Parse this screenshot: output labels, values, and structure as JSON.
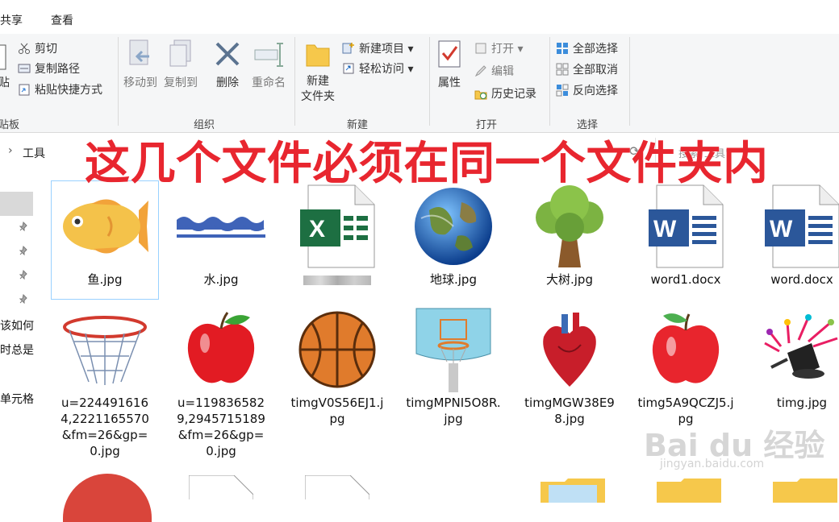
{
  "tabs": [
    "共享",
    "查看"
  ],
  "ribbon": {
    "clipboard": {
      "paste_partial": "贴",
      "group_partial": "贴板",
      "cut": "剪切",
      "copy_path": "复制路径",
      "paste_shortcut": "粘贴快捷方式"
    },
    "organize": {
      "label": "组织",
      "move_to": "移动到",
      "copy_to": "复制到",
      "delete": "删除",
      "rename": "重命名"
    },
    "new": {
      "label": "新建",
      "new_folder": "新建\n文件夹",
      "new_item": "新建项目 ▾",
      "easy_access": "轻松访问 ▾"
    },
    "open": {
      "label": "打开",
      "properties": "属性",
      "open": "打开 ▾",
      "edit": "编辑",
      "history": "历史记录"
    },
    "select": {
      "label": "选择",
      "select_all": "全部选择",
      "select_none": "全部取消",
      "invert": "反向选择"
    }
  },
  "address": {
    "path_chevron": "›",
    "folder": "工具",
    "search_partial": "搜索\"工具\""
  },
  "overlay_text": "这几个文件必须在同一个文件夹内",
  "sidebar": {
    "line1": "该如何",
    "line2": "时总是",
    "line3": "单元格"
  },
  "files": [
    {
      "name": "鱼.jpg",
      "icon": "fish-image"
    },
    {
      "name": "水.jpg",
      "icon": "water-wave-image"
    },
    {
      "name": "",
      "icon": "excel-file"
    },
    {
      "name": "地球.jpg",
      "icon": "earth-image"
    },
    {
      "name": "大树.jpg",
      "icon": "tree-image"
    },
    {
      "name": "word1.docx",
      "icon": "word-file"
    },
    {
      "name": "word.docx",
      "icon": "word-file"
    },
    {
      "name": "u=2244916164,2221165570&fm=26&gp=0.jpg",
      "icon": "basketball-hoop-image"
    },
    {
      "name": "u=1198365829,2945715189&fm=26&gp=0.jpg",
      "icon": "apple-image"
    },
    {
      "name": "timgV0S56EJ1.jpg",
      "icon": "basketball-image"
    },
    {
      "name": "timgMPNI5O8R.jpg",
      "icon": "hoop-stand-image"
    },
    {
      "name": "timgMGW38E98.jpg",
      "icon": "heart-image"
    },
    {
      "name": "timg5A9QCZJ5.jpg",
      "icon": "apple-image"
    },
    {
      "name": "timg.jpg",
      "icon": "magic-hat-image"
    }
  ],
  "watermark": {
    "brand": "Bai du 经验",
    "url": "jingyan.baidu.com"
  },
  "colors": {
    "overlay": "#e8262f",
    "excel": "#1d6f42",
    "word": "#2b579a",
    "selection": "#99d1ff"
  }
}
